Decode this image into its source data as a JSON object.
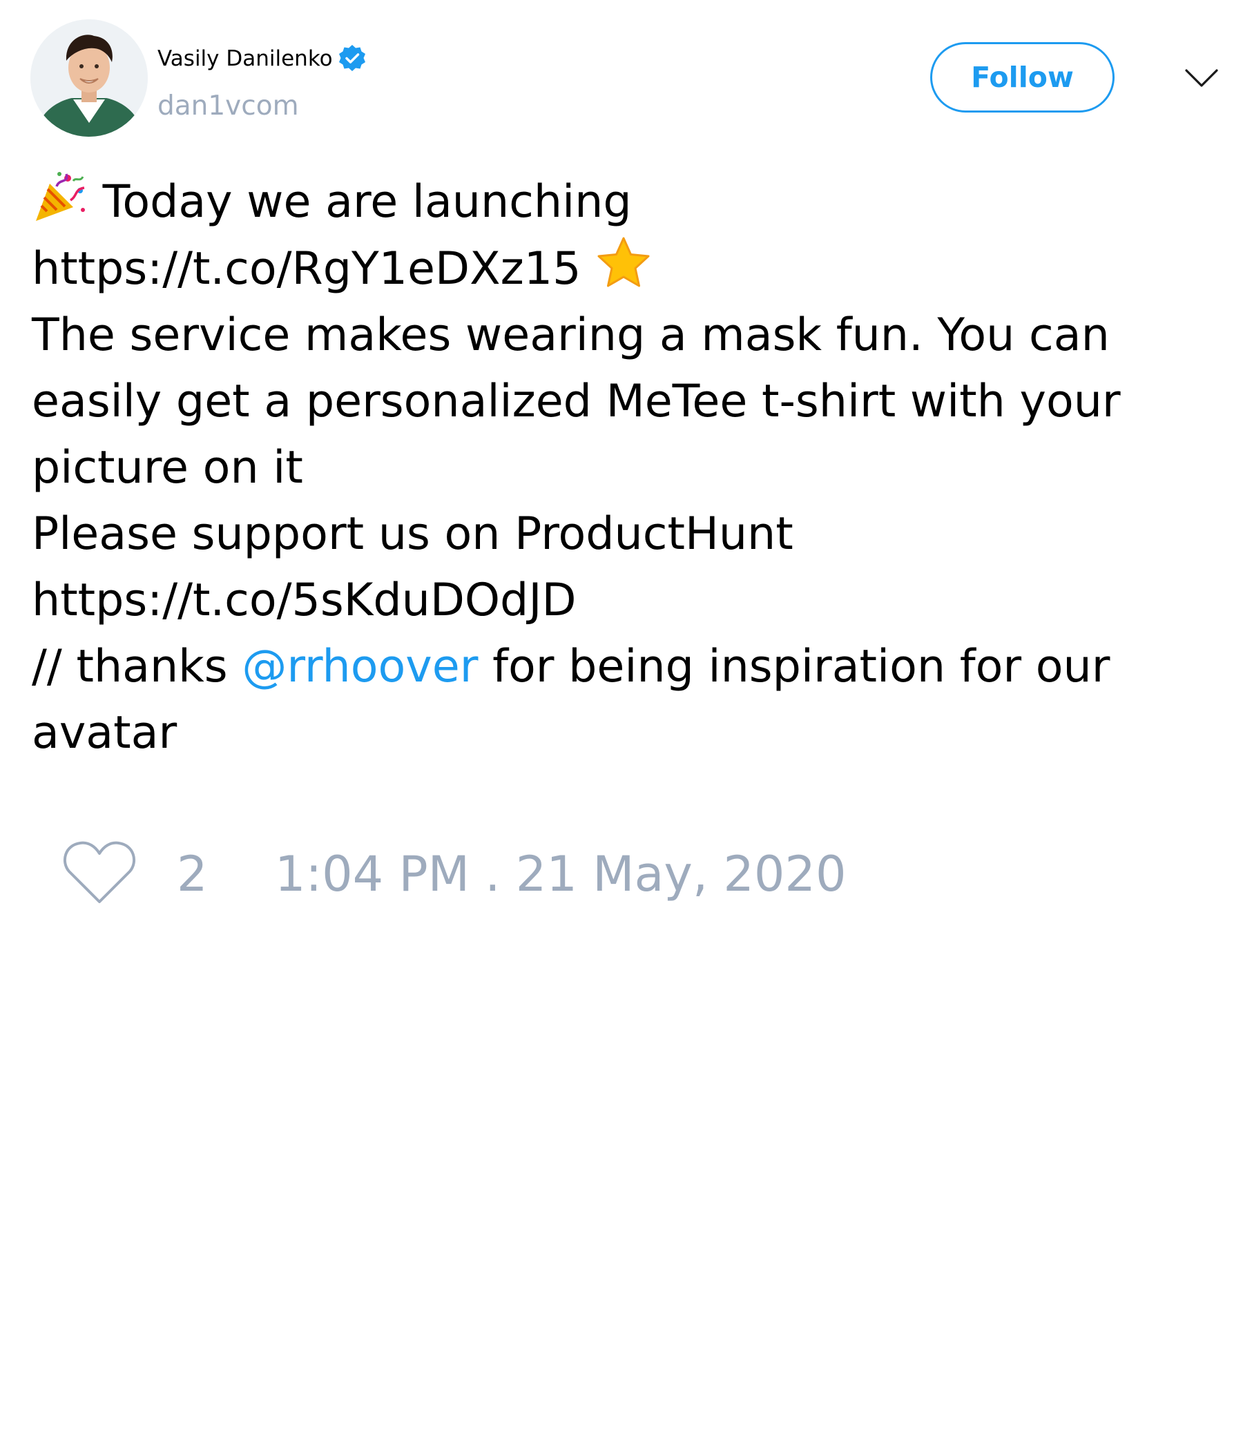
{
  "author": {
    "name": "Vasily Danilenko",
    "handle": "dan1vcom",
    "verified": true,
    "avatar_icon": "profile-photo"
  },
  "header": {
    "follow_label": "Follow",
    "more_icon": "chevron-down-icon"
  },
  "tweet": {
    "line1_emoji": "party-popper",
    "line1_text": " Today we are launching",
    "line2_link": "https://t.co/RgY1eDXz15",
    "line2_emoji": "star",
    "line3": "The service makes wearing a mask fun. You can",
    "line4": "easily get a personalized MeTee t-shirt with your",
    "line5": "picture on it",
    "line6": "Please support us on ProductHunt",
    "line7_link": "https://t.co/5sKduDOdJD",
    "line8_prefix": "// thanks ",
    "line8_mention": "@rrhoover",
    "line8_suffix": " for being inspiration for our",
    "line9": "avatar"
  },
  "footer": {
    "like_icon": "heart-icon",
    "like_count": "2",
    "timestamp": "1:04 PM . 21 May, 2020"
  },
  "colors": {
    "accent": "#1d9bf0",
    "muted": "#9eabbd",
    "text": "#000000",
    "background": "#ffffff"
  }
}
